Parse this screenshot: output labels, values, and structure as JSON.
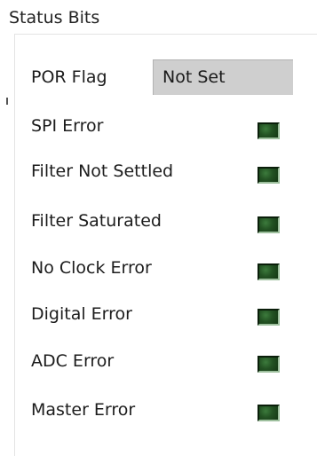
{
  "group": {
    "title": "Status Bits"
  },
  "por": {
    "label": "POR Flag",
    "value": "Not Set"
  },
  "status_rows": [
    {
      "label": "SPI Error",
      "led_color": "#235223"
    },
    {
      "label": "Filter Not Settled",
      "led_color": "#235223"
    },
    {
      "label": "Filter Saturated",
      "led_color": "#235223"
    },
    {
      "label": "No Clock Error",
      "led_color": "#235223"
    },
    {
      "label": "Digital Error",
      "led_color": "#235223"
    },
    {
      "label": "ADC Error",
      "led_color": "#235223"
    },
    {
      "label": "Master Error",
      "led_color": "#235223"
    }
  ]
}
